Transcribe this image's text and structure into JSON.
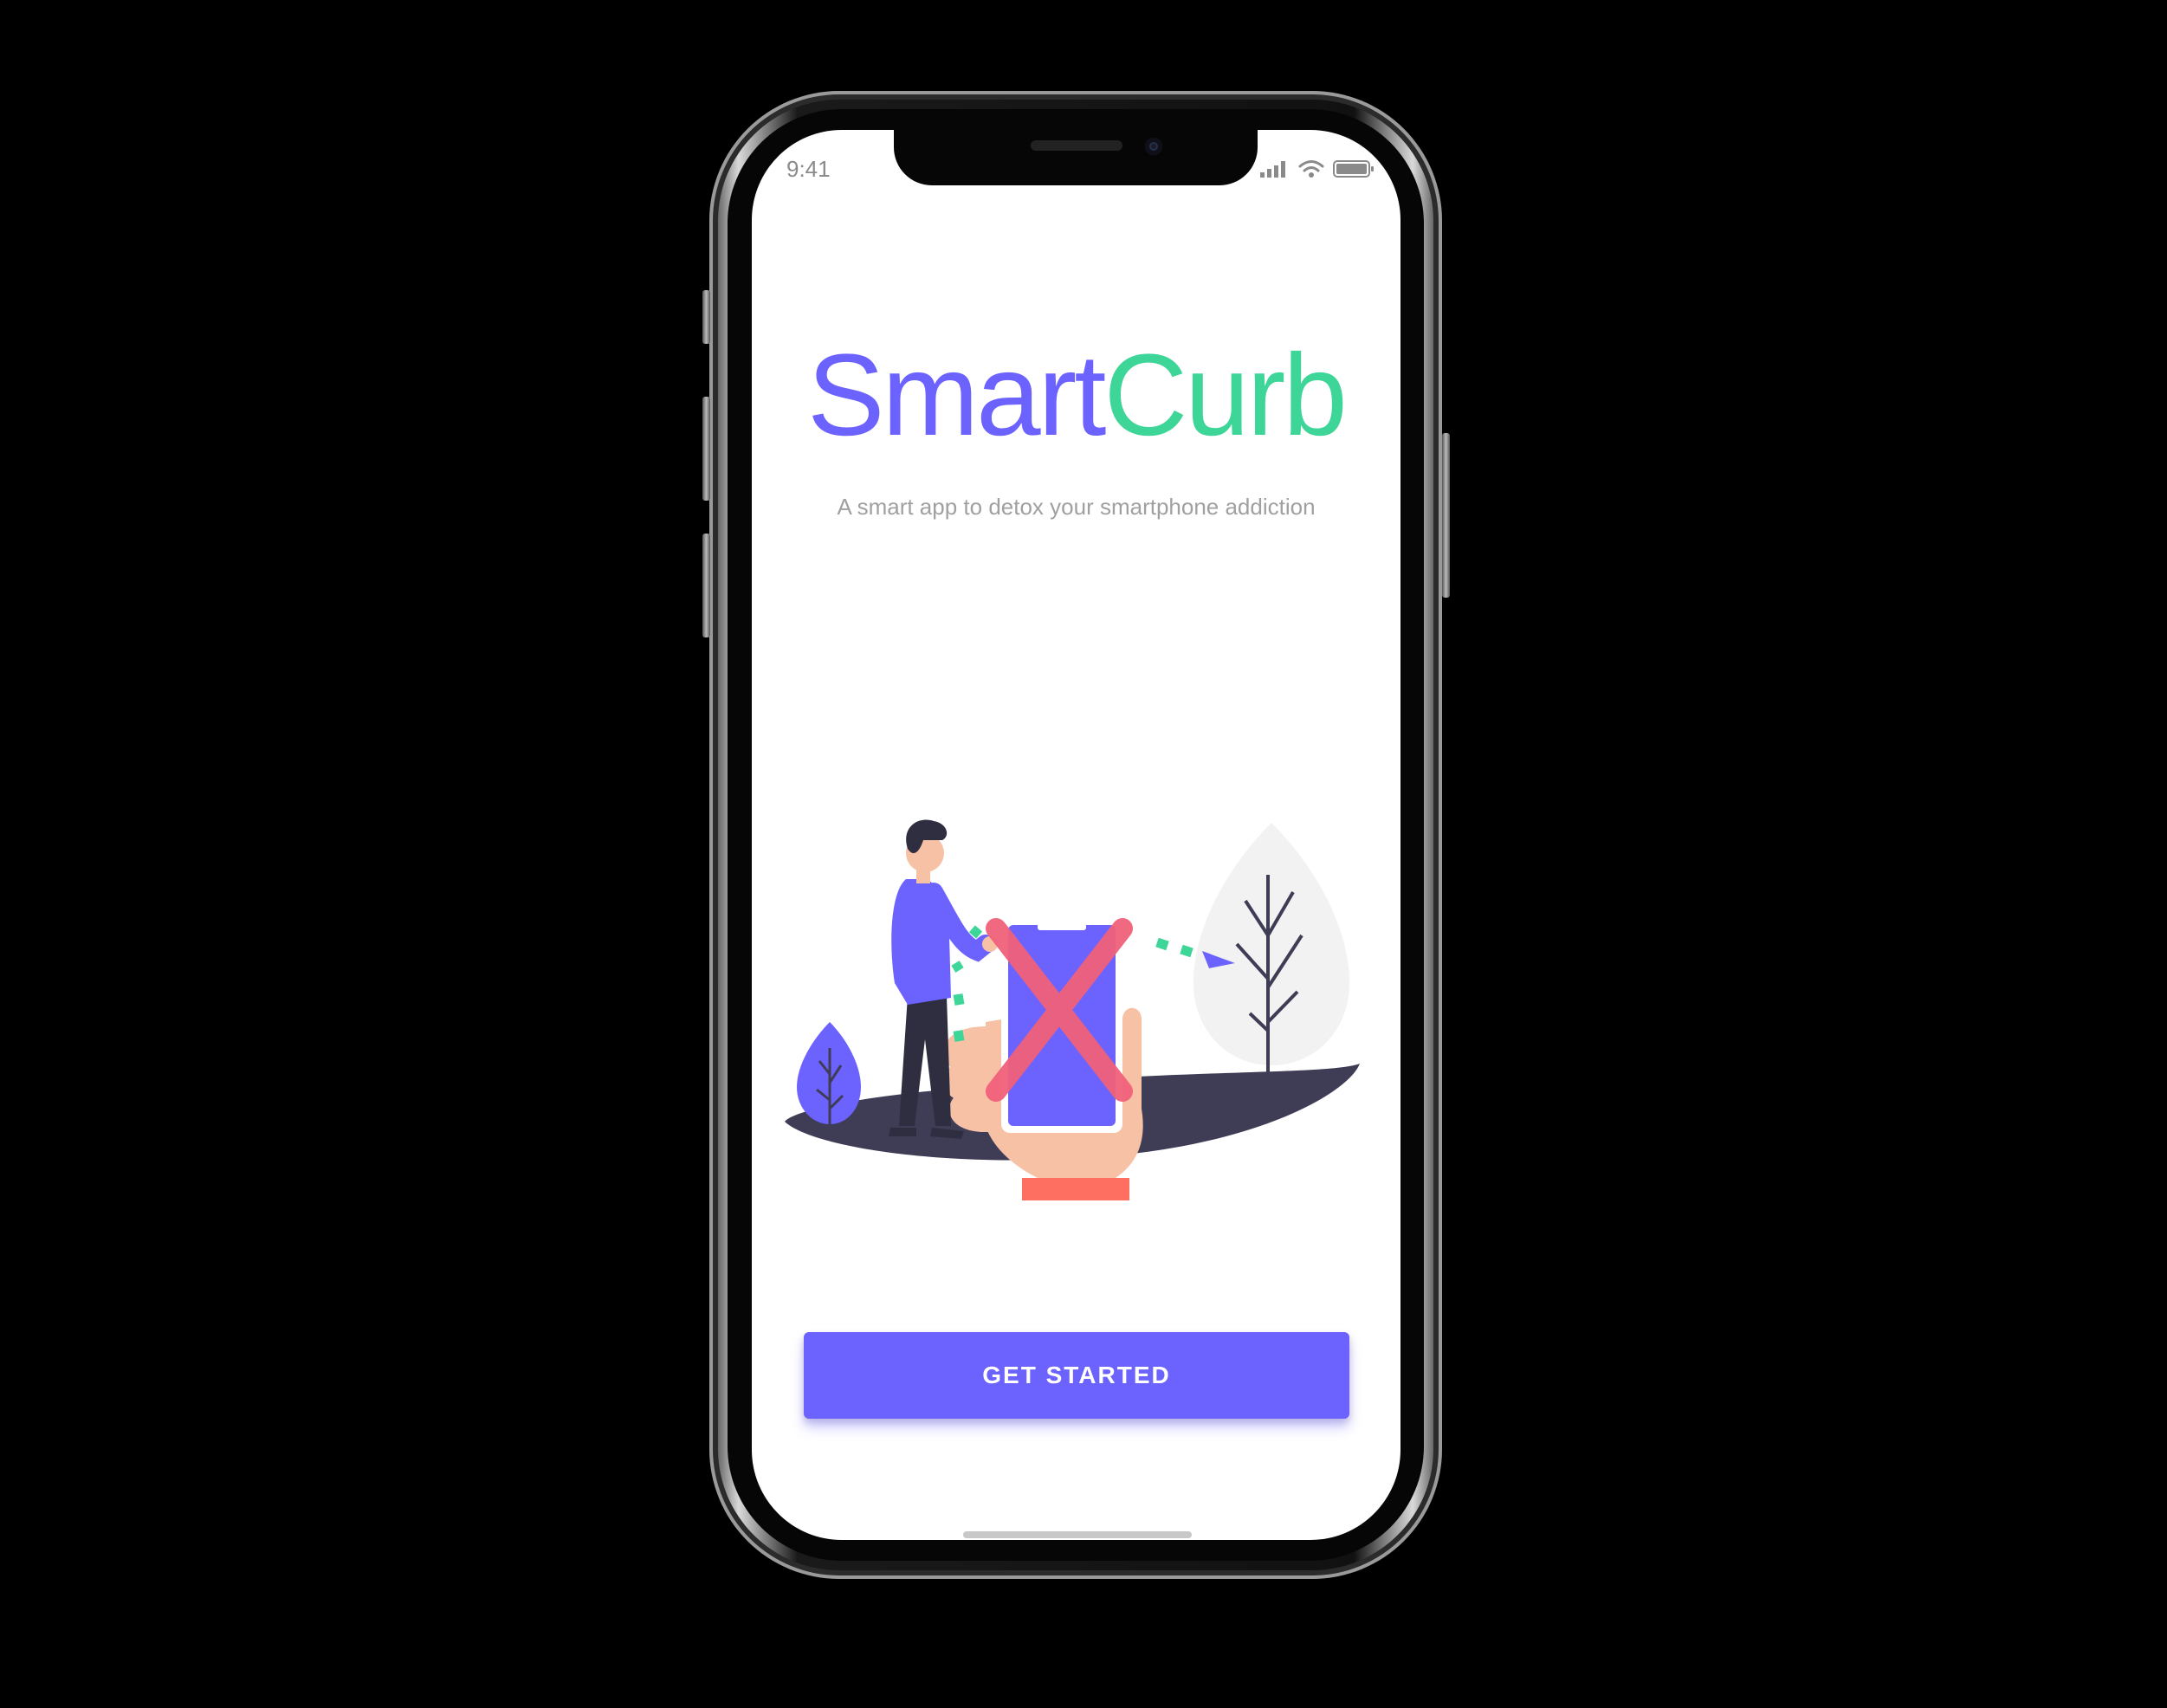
{
  "status_bar": {
    "time": "9:41",
    "icons": [
      "signal-icon",
      "wifi-icon",
      "battery-icon"
    ]
  },
  "app": {
    "title_part_1": "Smart",
    "title_part_2": "Curb",
    "tagline": "A smart app to detox your smartphone addiction"
  },
  "cta": {
    "label": "GET STARTED"
  },
  "colors": {
    "primary": "#6c63ff",
    "accent": "#3ed598",
    "cross": "#f0607a",
    "skin": "#f7c1a6",
    "ground": "#3f3d56",
    "tree": "#f2f2f2"
  },
  "illustration": {
    "name": "phone-detox-illustration"
  }
}
